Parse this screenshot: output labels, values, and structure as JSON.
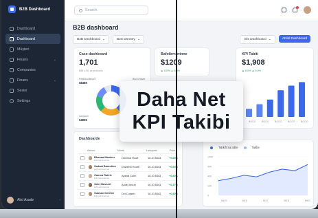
{
  "sidebar": {
    "brand": "B2B Dashboard",
    "items": [
      {
        "label": "Dashboard"
      },
      {
        "label": "Dashboard"
      },
      {
        "label": "Müşteri"
      },
      {
        "label": "Finans"
      },
      {
        "label": "Companies"
      },
      {
        "label": "Finans"
      },
      {
        "label": "Sesini"
      },
      {
        "label": "Settings"
      }
    ],
    "user_name": "Abd Asade"
  },
  "topbar": {
    "search_placeholder": "Search"
  },
  "main": {
    "title": "B2B dashboard",
    "filter1": "B2B Dashboard",
    "filter2": "B2S Dsnntry",
    "filter3": "Alls Dashboard",
    "primary_button": "ARibl Dashboard"
  },
  "cards": {
    "case": {
      "title": "Case dashboard",
      "value": "1,701",
      "sub": "$38 ≤ $0 at products",
      "legend1_label": "Peatdicollimuni",
      "legend1_value": "$8488",
      "legend2_label": "Bisl Gnavst",
      "legend3_label": "Lwntcom",
      "legend3_value": "$4808"
    },
    "perf": {
      "title": "Bafotirrrantnne",
      "value": "$1209",
      "sub": "▲ 8.0% ▲ 8.3%"
    },
    "kpi": {
      "title": "KPI Tabiti",
      "value": "$1,908",
      "sub": "▲ 8.0% ▲ 5.0%",
      "x_labels": [
        "BOOO",
        "BOOO",
        "BOOO",
        "BOOO",
        "BOOO"
      ]
    },
    "table": {
      "title": "Dashboarde",
      "headers": [
        "Aamed",
        "Month",
        "Lastupent",
        "Point"
      ],
      "rows": [
        {
          "name": "Bhanaa Mamber",
          "sub": "Edit administrasi",
          "c2": "Oonesol Rouft",
          "c3": "18.10.5343",
          "c4": "+0.85%"
        },
        {
          "name": "Sadaat Bamotion",
          "sub": "Edit administrasi",
          "c2": "Doweirlo Routh",
          "c3": "18.10.5343",
          "c4": "+0.80%"
        },
        {
          "name": "Camoa Rafele",
          "sub": "Edit administrasi",
          "c2": "Apsbill Cuhh",
          "c3": "18.10.5343",
          "c4": "+0.80%"
        },
        {
          "name": "Sole Slavsort",
          "sub": "Edit administrasi",
          "c2": "Aodel Arouh",
          "c3": "18.10.5343",
          "c4": "+0.37%"
        },
        {
          "name": "Subhan Delefee",
          "sub": "Edit administrasi",
          "c2": "Del Cosseh",
          "c3": "18.10.5343",
          "c4": "+0.80%"
        }
      ]
    },
    "line": {
      "legend1": "Tabkift Sa.toble",
      "legend2": "Takbe",
      "y_labels": [
        "100K",
        "40K",
        "40K",
        "10K",
        "0"
      ],
      "x_labels": [
        "MKSi",
        "MKS",
        "Mi.S",
        "MKS",
        "MKS"
      ]
    }
  },
  "overlay": {
    "line1": "Daha Net",
    "line2": "KPI Takibi"
  },
  "chart_data": [
    {
      "type": "pie",
      "title": "Case dashboard",
      "values": [
        40,
        22,
        18,
        12,
        8
      ],
      "colors": [
        "#3a69f0",
        "#f5a623",
        "#2bb673",
        "#6a8cff",
        "#e4e9f1"
      ]
    },
    {
      "type": "bar",
      "title": "KPI Tabiti",
      "x_labels": [
        "BOOO",
        "BOOO",
        "BOOO",
        "BOOO",
        "BOOO"
      ],
      "values": [
        14,
        22,
        30,
        46,
        54,
        60
      ],
      "ylim": [
        0,
        64
      ]
    },
    {
      "type": "area",
      "legend": [
        "Tabkift Sa.toble",
        "Takbe"
      ],
      "x_labels": [
        "MKSi",
        "MKS",
        "Mi.S",
        "MKS",
        "MKS"
      ],
      "y_labels": [
        "100K",
        "40K",
        "40K",
        "10K",
        "0"
      ],
      "values": [
        38,
        44,
        52,
        48,
        60,
        68,
        64,
        80
      ]
    }
  ]
}
